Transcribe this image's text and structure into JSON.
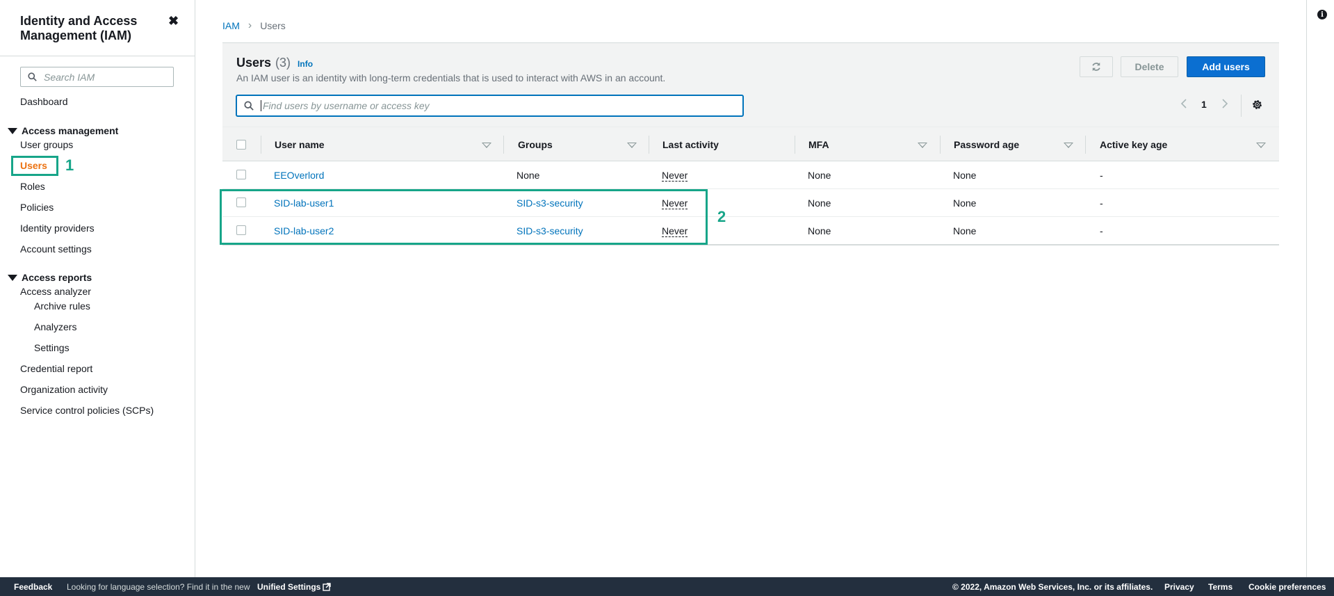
{
  "sidebar": {
    "title": "Identity and Access Management (IAM)",
    "search_placeholder": "Search IAM",
    "dashboard": "Dashboard",
    "access_management": {
      "label": "Access management",
      "items": [
        "User groups",
        "Users",
        "Roles",
        "Policies",
        "Identity providers",
        "Account settings"
      ]
    },
    "access_reports": {
      "label": "Access reports",
      "items": [
        "Access analyzer",
        "Archive rules",
        "Analyzers",
        "Settings",
        "Credential report",
        "Organization activity",
        "Service control policies (SCPs)"
      ]
    },
    "active_item": "Users"
  },
  "annotations": {
    "marker_1": "1",
    "marker_2": "2",
    "color": "#17a589"
  },
  "breadcrumb": {
    "root": "IAM",
    "current": "Users"
  },
  "panel": {
    "title": "Users",
    "count": "(3)",
    "info": "Info",
    "description": "An IAM user is an identity with long-term credentials that is used to interact with AWS in an account.",
    "delete_label": "Delete",
    "add_label": "Add users",
    "find_placeholder": "Find users by username or access key",
    "page": "1"
  },
  "table": {
    "columns": [
      "User name",
      "Groups",
      "Last activity",
      "MFA",
      "Password age",
      "Active key age"
    ],
    "rows": [
      {
        "user": "EEOverlord",
        "groups": "None",
        "last_activity": "Never",
        "mfa": "None",
        "password_age": "None",
        "key_age": "-"
      },
      {
        "user": "SID-lab-user1",
        "groups": "SID-s3-security",
        "last_activity": "Never",
        "mfa": "None",
        "password_age": "None",
        "key_age": "-"
      },
      {
        "user": "SID-lab-user2",
        "groups": "SID-s3-security",
        "last_activity": "Never",
        "mfa": "None",
        "password_age": "None",
        "key_age": "-"
      }
    ]
  },
  "footer": {
    "feedback": "Feedback",
    "language_note": "Looking for language selection? Find it in the new",
    "unified_settings": "Unified Settings",
    "copyright": "© 2022, Amazon Web Services, Inc. or its affiliates.",
    "privacy": "Privacy",
    "terms": "Terms",
    "cookies": "Cookie preferences"
  },
  "colors": {
    "link": "#0073bb",
    "active": "#ec7211",
    "primary_button": "#0b6fd1",
    "footer_bg": "#232f3e"
  }
}
